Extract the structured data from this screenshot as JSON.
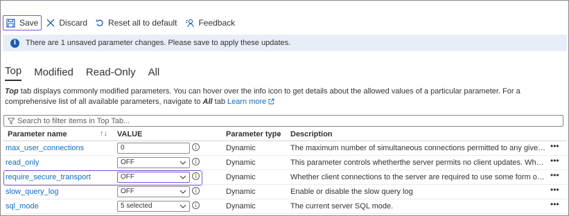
{
  "toolbar": {
    "save_label": "Save",
    "discard_label": "Discard",
    "reset_label": "Reset all to default",
    "feedback_label": "Feedback"
  },
  "infobar": {
    "message": "There are 1 unsaved parameter changes.  Please save to apply these updates."
  },
  "tabs": [
    {
      "label": "Top",
      "active": true
    },
    {
      "label": "Modified",
      "active": false
    },
    {
      "label": "Read-Only",
      "active": false
    },
    {
      "label": "All",
      "active": false
    }
  ],
  "description": {
    "part1": "Top",
    "part2": " tab displays commonly modified parameters. You can hover over the info icon to get details about the allowed values of a particular parameter. For a comprehensive list of all available parameters, navigate to ",
    "part3": "All",
    "part4": " tab ",
    "learn_more": "Learn more"
  },
  "search": {
    "placeholder": "Search to filter items in Top Tab..."
  },
  "table": {
    "headers": {
      "name": "Parameter name",
      "value": "VALUE",
      "type": "Parameter type",
      "description": "Description"
    },
    "rows": [
      {
        "name": "max_user_connections",
        "value": "0",
        "has_dropdown": false,
        "type": "Dynamic",
        "description": "The maximum number of simultaneous connections permitted to any given MySQL user account."
      },
      {
        "name": "read_only",
        "value": "OFF",
        "has_dropdown": true,
        "type": "Dynamic",
        "description": "This parameter controls whetherthe server permits no client updates. When the server is read read-only."
      },
      {
        "name": "require_secure_transport",
        "value": "OFF",
        "has_dropdown": true,
        "type": "Dynamic",
        "description": "Whether client connections to the server are required to use some form of secure transport. When enabled."
      },
      {
        "name": "slow_query_log",
        "value": "OFF",
        "has_dropdown": true,
        "type": "Dynamic",
        "description": "Enable or disable the slow query log"
      },
      {
        "name": "sql_mode",
        "value": "5 selected",
        "has_dropdown": true,
        "type": "Dynamic",
        "description": "The current server SQL mode."
      }
    ]
  },
  "icons": {
    "save": "save-icon",
    "discard": "close-icon",
    "reset": "undo-icon",
    "feedback": "feedback-icon",
    "info": "info-icon",
    "filter": "filter-icon",
    "external": "external-link-icon",
    "more": "more-icon"
  },
  "colors": {
    "accent": "#7a55e0",
    "link": "#0f6cbd",
    "infobar_bg": "#e8eef8",
    "info_icon": "#1a5cb0"
  }
}
